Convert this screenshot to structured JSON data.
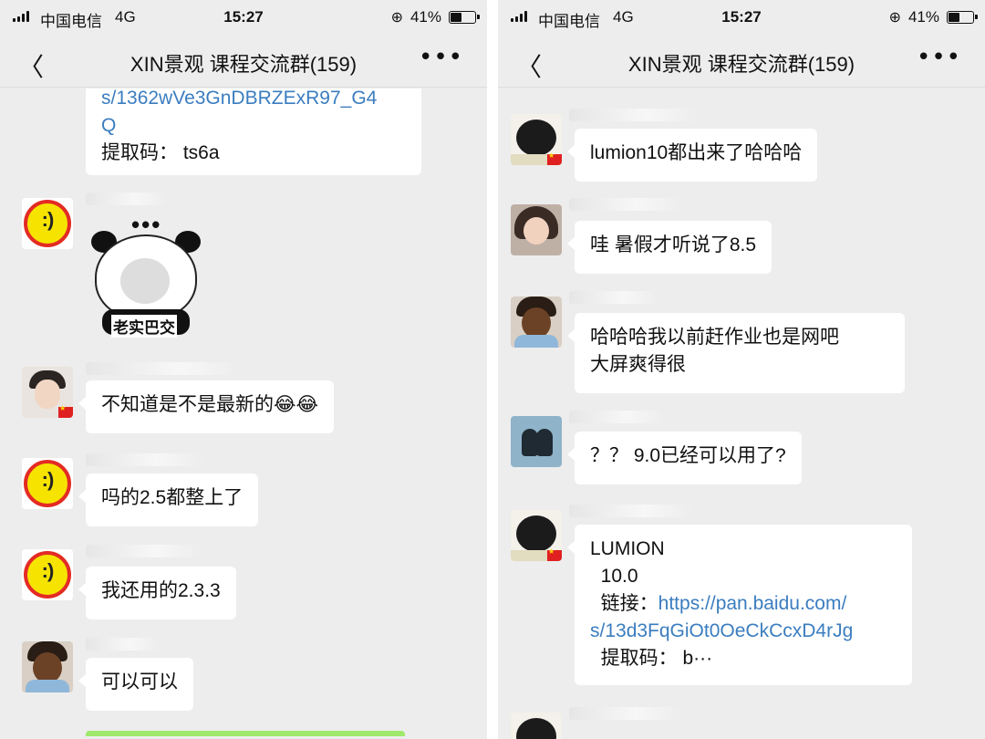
{
  "status": {
    "carrier": "中国电信",
    "network": "4G",
    "time": "15:27",
    "battery": "41%"
  },
  "nav": {
    "back": "〈",
    "title": "XIN景观 课程交流群(159)",
    "more": "•••"
  },
  "left_chat": {
    "top_bubble_lines": [
      "s/1362wVe3GnDBRZExR97_G4",
      "Q"
    ],
    "top_bubble_code": " 提取码： ts6a",
    "sticker_caption": "老实巴交",
    "msg1": "不知道是不是最新的😂😂",
    "msg2": "吗的2.5都整上了",
    "msg3": "我还用的2.3.3",
    "msg4": "可以可以"
  },
  "right_chat": {
    "msg1": "lumion10都出来了哈哈哈",
    "msg2": "哇 暑假才听说了8.5",
    "msg3_line1": "哈哈哈我以前赶作业也是网吧",
    "msg3_line2": "大屏爽得很",
    "msg4": "？？ 9.0已经可以用了?",
    "share_title": "LUMION",
    "share_version": "  10.0",
    "share_link_label": "  链接：",
    "share_link_part1": "https://pan.baidu.com/",
    "share_link_part2": "s/13d3FqGiOt0OeCkCcxD4rJg",
    "share_code": "  提取码： b···"
  },
  "icons": [
    "signal-icon",
    "lock-rotation-icon",
    "battery-icon",
    "back-icon",
    "more-icon"
  ]
}
